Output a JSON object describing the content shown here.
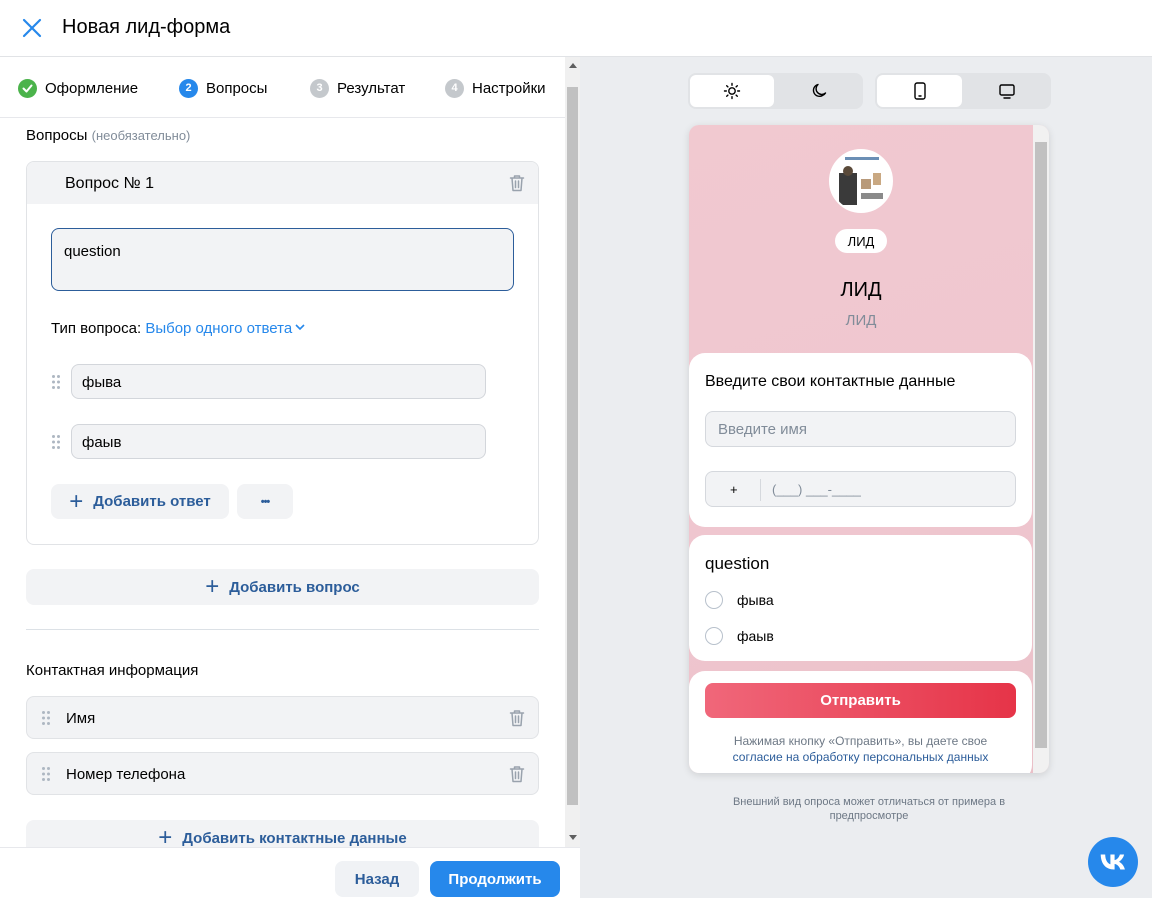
{
  "header": {
    "title": "Новая лид-форма"
  },
  "steps": [
    {
      "num": "",
      "label": "Оформление",
      "state": "done"
    },
    {
      "num": "2",
      "label": "Вопросы",
      "state": "active"
    },
    {
      "num": "3",
      "label": "Результат",
      "state": "pending"
    },
    {
      "num": "4",
      "label": "Настройки",
      "state": "pending"
    }
  ],
  "questions_section": {
    "label": "Вопросы",
    "optional": "(необязательно)"
  },
  "question": {
    "title": "Вопрос № 1",
    "text": "question",
    "type_label": "Тип вопроса:",
    "type_value": "Выбор одного ответа",
    "answers": [
      "фыва",
      "фаыв"
    ],
    "add_answer": "Добавить ответ",
    "more": "•••"
  },
  "add_question": "Добавить вопрос",
  "contact_section": {
    "label": "Контактная информация",
    "items": [
      "Имя",
      "Номер телефона"
    ],
    "add": "Добавить контактные данные"
  },
  "footer": {
    "back": "Назад",
    "next": "Продолжить"
  },
  "colors": {
    "accent": "#2688eb",
    "done": "#4bb34b",
    "pending": "#aeb7c2",
    "send_start": "#f0677a",
    "send_end": "#e63448"
  },
  "preview": {
    "badge": "ЛИД",
    "title": "ЛИД",
    "subtitle": "ЛИД",
    "contact_title": "Введите свои контактные данные",
    "name_placeholder": "Введите имя",
    "phone_prefix": "+",
    "phone_mask": "(___) ___-____",
    "question": "question",
    "options": [
      "фыва",
      "фаыв"
    ],
    "send": "Отправить",
    "consent_text": "Нажимая кнопку «Отправить», вы даете свое",
    "consent_link": "согласие на обработку персональных данных",
    "disclaimer": "Внешний вид опроса может отличаться от примера в предпросмотре"
  }
}
